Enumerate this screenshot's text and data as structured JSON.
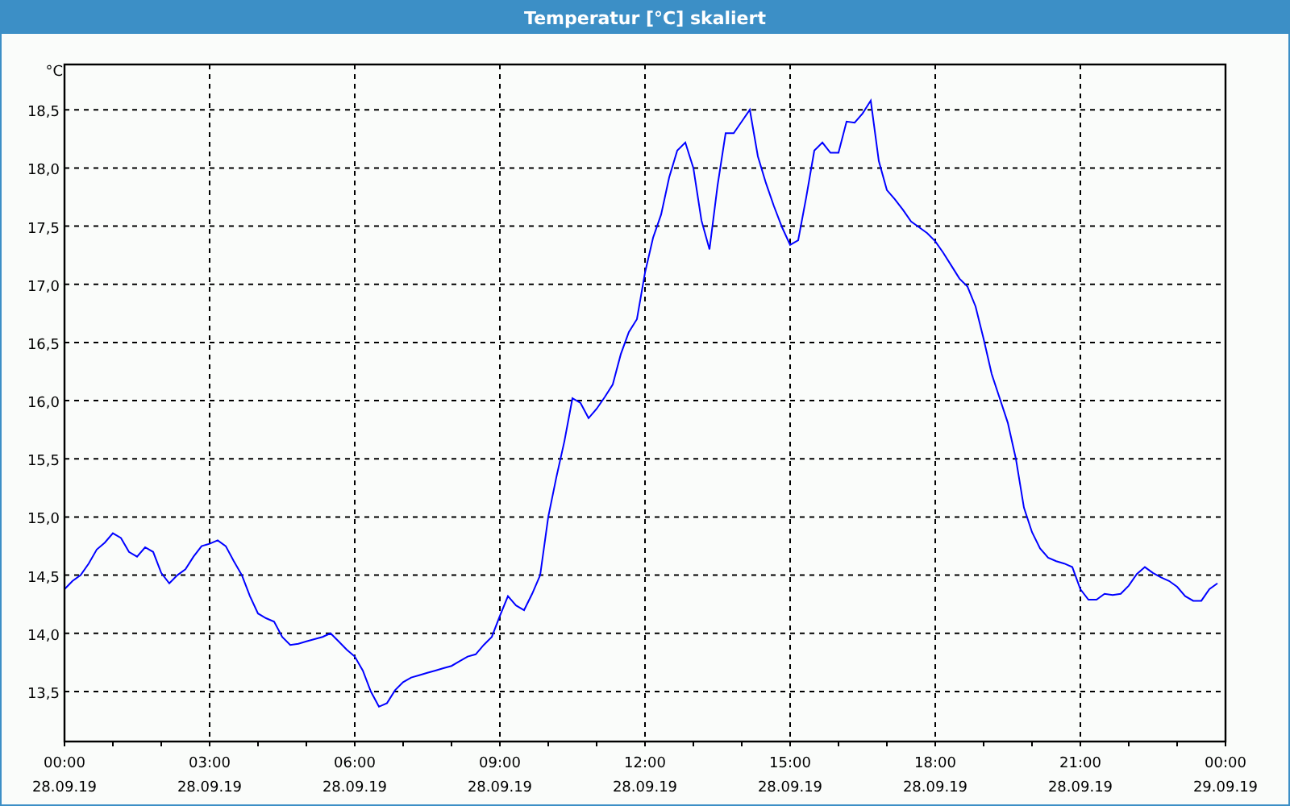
{
  "window": {
    "title": "Temperatur [°C] skaliert"
  },
  "chart": {
    "chart_data": {
      "type": "line",
      "grid": true,
      "ylabel": "°C",
      "ylim": [
        13.07,
        18.89
      ],
      "yticks": [
        {
          "value": 13.5,
          "label": "13,5"
        },
        {
          "value": 14,
          "label": "14,0"
        },
        {
          "value": 14.5,
          "label": "14,5"
        },
        {
          "value": 15,
          "label": "15,0"
        },
        {
          "value": 15.5,
          "label": "15,5"
        },
        {
          "value": 16,
          "label": "16,0"
        },
        {
          "value": 16.5,
          "label": "16,5"
        },
        {
          "value": 17,
          "label": "17,0"
        },
        {
          "value": 17.5,
          "label": "17,5"
        },
        {
          "value": 18,
          "label": "18,0"
        },
        {
          "value": 18.5,
          "label": "18,5"
        }
      ],
      "categories": [
        "00:00\n28.09.19",
        null,
        null,
        null,
        null,
        null,
        null,
        null,
        null,
        null,
        null,
        null,
        null,
        null,
        null,
        null,
        null,
        null,
        "03:00\n28.09.19",
        null,
        null,
        null,
        null,
        null,
        null,
        null,
        null,
        null,
        null,
        null,
        null,
        null,
        null,
        null,
        null,
        null,
        "06:00\n28.09.19",
        null,
        null,
        null,
        null,
        null,
        null,
        null,
        null,
        null,
        null,
        null,
        null,
        null,
        null,
        null,
        null,
        null,
        "09:00\n28.09.19",
        null,
        null,
        null,
        null,
        null,
        null,
        null,
        null,
        null,
        null,
        null,
        null,
        null,
        null,
        null,
        null,
        null,
        "12:00\n28.09.19",
        null,
        null,
        null,
        null,
        null,
        null,
        null,
        null,
        null,
        null,
        null,
        null,
        null,
        null,
        null,
        null,
        null,
        "15:00\n28.09.19",
        null,
        null,
        null,
        null,
        null,
        null,
        null,
        null,
        null,
        null,
        null,
        null,
        null,
        null,
        null,
        null,
        null,
        "18:00\n28.09.19",
        null,
        null,
        null,
        null,
        null,
        null,
        null,
        null,
        null,
        null,
        null,
        null,
        null,
        null,
        null,
        null,
        null,
        "21:00\n28.09.19",
        null,
        null,
        null,
        null,
        null,
        null,
        null,
        null,
        null,
        null,
        null,
        null,
        null,
        null,
        null,
        null,
        null,
        "00:00\n29.09.19"
      ],
      "series": [
        {
          "color": "#0000ff",
          "values": [
            14.38,
            14.45,
            14.5,
            14.6,
            14.72,
            14.78,
            14.86,
            14.82,
            14.7,
            14.66,
            14.74,
            14.7,
            14.52,
            14.43,
            14.5,
            14.55,
            14.66,
            14.75,
            14.77,
            14.8,
            14.75,
            14.62,
            14.5,
            14.32,
            14.17,
            14.13,
            14.1,
            13.97,
            13.9,
            13.91,
            13.93,
            13.95,
            13.97,
            14.0,
            13.93,
            13.86,
            13.8,
            13.68,
            13.5,
            13.37,
            13.4,
            13.51,
            13.58,
            13.62,
            13.64,
            13.66,
            13.68,
            13.7,
            13.72,
            13.76,
            13.8,
            13.82,
            13.9,
            13.97,
            14.15,
            14.32,
            14.24,
            14.2,
            14.34,
            14.5,
            15.0,
            15.34,
            15.65,
            16.02,
            15.98,
            15.85,
            15.93,
            16.03,
            16.14,
            16.4,
            16.59,
            16.7,
            17.1,
            17.4,
            17.6,
            17.92,
            18.15,
            18.22,
            18.0,
            17.55,
            17.3,
            17.85,
            18.3,
            18.3,
            18.4,
            18.5,
            18.1,
            17.87,
            17.67,
            17.49,
            17.34,
            17.38,
            17.75,
            18.15,
            18.22,
            18.13,
            18.13,
            18.4,
            18.39,
            18.47,
            18.58,
            18.06,
            17.81,
            17.73,
            17.64,
            17.54,
            17.49,
            17.44,
            17.37,
            17.27,
            17.16,
            17.05,
            16.98,
            16.81,
            16.53,
            16.23,
            16.02,
            15.81,
            15.5,
            15.08,
            14.87,
            14.73,
            14.65,
            14.62,
            14.6,
            14.57,
            14.38,
            14.29,
            14.29,
            14.34,
            14.33,
            14.34,
            14.41,
            14.51,
            14.57,
            14.52,
            14.48,
            14.45,
            14.4,
            14.32,
            14.28,
            14.28,
            14.38,
            14.43,
            null
          ]
        }
      ]
    }
  }
}
